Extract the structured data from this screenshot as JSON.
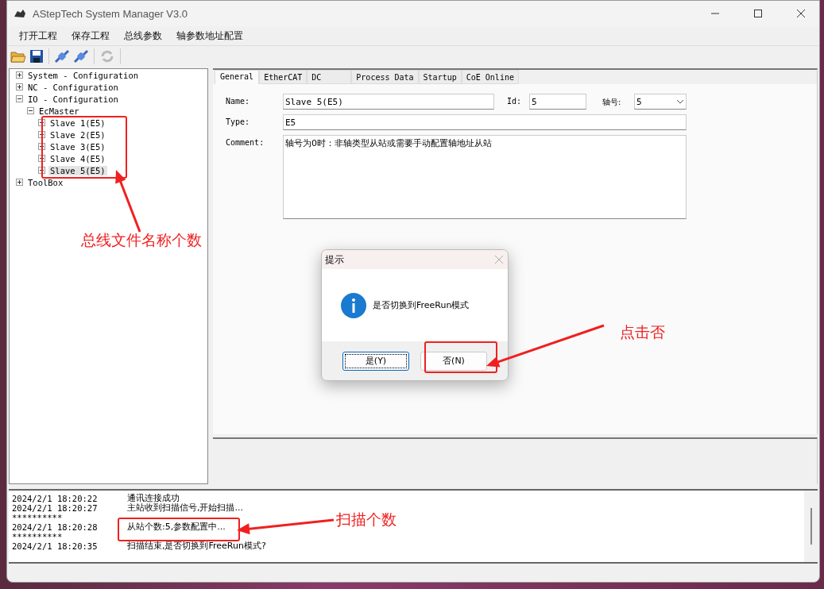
{
  "window": {
    "title": "AStepTech System Manager V3.0"
  },
  "menu": [
    "打开工程",
    "保存工程",
    "总线参数",
    "轴参数地址配置"
  ],
  "tree": [
    {
      "label": "System - Configuration",
      "expanded": false,
      "selected": false
    },
    {
      "label": "NC - Configuration",
      "expanded": false,
      "selected": false
    },
    {
      "label": "IO - Configuration",
      "expanded": true,
      "selected": false,
      "children": [
        {
          "label": "EcMaster",
          "expanded": true,
          "selected": false,
          "children": [
            {
              "label": "Slave 1(E5)",
              "expanded": false,
              "selected": false
            },
            {
              "label": "Slave 2(E5)",
              "expanded": false,
              "selected": false
            },
            {
              "label": "Slave 3(E5)",
              "expanded": false,
              "selected": false
            },
            {
              "label": "Slave 4(E5)",
              "expanded": false,
              "selected": false
            },
            {
              "label": "Slave 5(E5)",
              "expanded": false,
              "selected": true
            }
          ]
        }
      ]
    },
    {
      "label": "ToolBox",
      "expanded": false,
      "selected": false
    }
  ],
  "tabs": [
    {
      "label": "General",
      "selected": true
    },
    {
      "label": "EtherCAT",
      "selected": false
    },
    {
      "label": "DC",
      "selected": false
    },
    {
      "label": "Process Data",
      "selected": false
    },
    {
      "label": "Startup",
      "selected": false
    },
    {
      "label": "CoE Online",
      "selected": false
    }
  ],
  "form": {
    "name_label": "Name:",
    "name": "Slave 5(E5)",
    "id_label": "Id:",
    "id": "5",
    "axis_label": "轴号:",
    "axis": "5",
    "type_label": "Type:",
    "type": "E5",
    "comment_label": "Comment:",
    "comment": "轴号为0时：非轴类型从站或需要手动配置轴地址从站"
  },
  "dialog": {
    "title": "提示",
    "message": "是否切换到FreeRun模式",
    "buttons": [
      {
        "label": "是(Y)",
        "focused": true
      },
      {
        "label": "否(N)",
        "focused": false
      }
    ]
  },
  "log": [
    {
      "kind": "entry",
      "time": "2024/2/1 18:20:22",
      "message": "通讯连接成功"
    },
    {
      "kind": "entry",
      "time": "2024/2/1 18:20:27",
      "message": "主站收到扫描信号,开始扫描..."
    },
    {
      "kind": "separator",
      "text": "**********"
    },
    {
      "kind": "entry",
      "time": "2024/2/1 18:20:28",
      "message": "从站个数:5,参数配置中..."
    },
    {
      "kind": "separator",
      "text": "**********"
    },
    {
      "kind": "entry",
      "time": "2024/2/1 18:20:35",
      "message": "扫描结束,是否切换到FreeRun模式?"
    }
  ],
  "annotations": [
    {
      "text": "总线文件名称个数"
    },
    {
      "text": "点击否"
    },
    {
      "text": "扫描个数"
    }
  ]
}
